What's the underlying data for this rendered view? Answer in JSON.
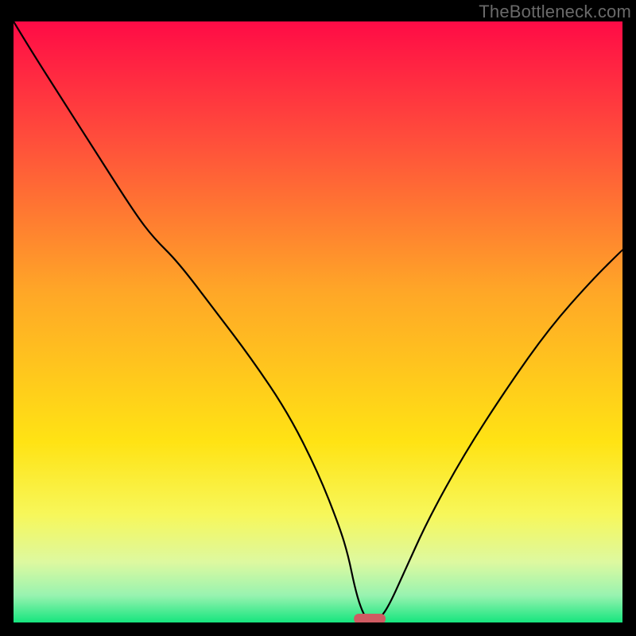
{
  "watermark": "TheBottleneck.com",
  "chart_data": {
    "type": "line",
    "title": "",
    "xlabel": "",
    "ylabel": "",
    "xlim": [
      0,
      100
    ],
    "ylim": [
      0,
      100
    ],
    "grid": false,
    "legend": false,
    "background": {
      "type": "vertical-gradient",
      "stops": [
        {
          "pos": 0.0,
          "color": "#ff0b46"
        },
        {
          "pos": 0.2,
          "color": "#ff4f3b"
        },
        {
          "pos": 0.45,
          "color": "#ffa727"
        },
        {
          "pos": 0.7,
          "color": "#ffe314"
        },
        {
          "pos": 0.82,
          "color": "#f7f75a"
        },
        {
          "pos": 0.9,
          "color": "#ddf9a0"
        },
        {
          "pos": 0.955,
          "color": "#98f3b0"
        },
        {
          "pos": 1.0,
          "color": "#16e57e"
        }
      ]
    },
    "series": [
      {
        "name": "bottleneck-curve",
        "x": [
          0,
          3,
          8,
          14,
          20,
          23,
          27,
          33,
          39,
          45,
          50,
          53.5,
          55,
          56,
          57,
          58,
          60,
          61.5,
          64,
          68,
          74,
          81,
          88,
          95,
          100
        ],
        "y": [
          100,
          95,
          87,
          77.5,
          68,
          64,
          60,
          52,
          44,
          35,
          25,
          16,
          11,
          6,
          2.5,
          0.5,
          0.5,
          2.5,
          8,
          17,
          28,
          39,
          49,
          57,
          62
        ]
      }
    ],
    "marker": {
      "name": "optimal-point",
      "x": 58.5,
      "width": 5.2,
      "y": 0.6,
      "color": "#cf5b62"
    }
  }
}
